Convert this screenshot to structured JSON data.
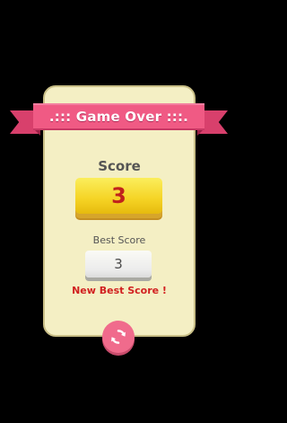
{
  "title": ".::: Game Over :::.",
  "score": {
    "label": "Score",
    "value": "3"
  },
  "best": {
    "label": "Best Score",
    "value": "3"
  },
  "new_best_text": "New Best Score !",
  "icons": {
    "replay": "replay-icon"
  },
  "colors": {
    "background": "#000000",
    "card": "#f4efc4",
    "ribbon": "#f05a84",
    "score_box": "#f5d324",
    "score_text": "#c0231c",
    "new_best": "#d12020",
    "replay_button": "#f06b8c"
  }
}
